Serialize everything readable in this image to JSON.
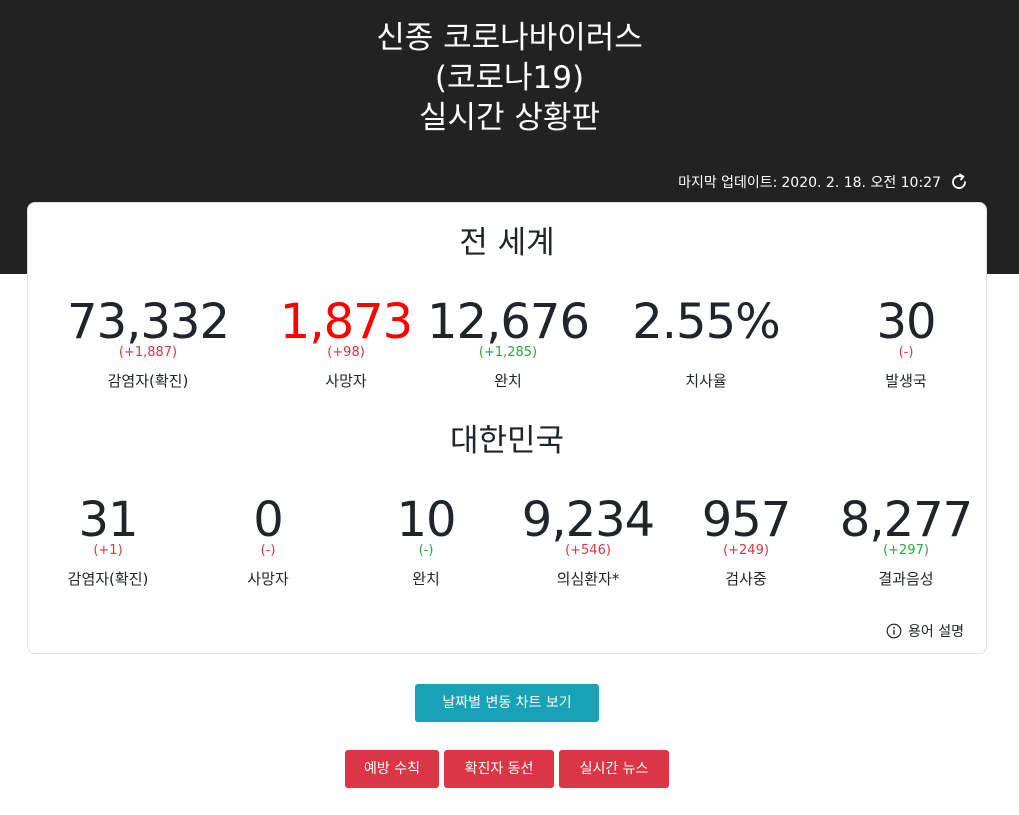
{
  "header": {
    "title_line1": "신종 코로나바이러스",
    "title_line2": "(코로나19)",
    "title_line3": "실시간 상황판",
    "update_label": "마지막 업데이트:",
    "update_time": "2020. 2. 18. 오전 10:27",
    "refresh_icon": "refresh-icon"
  },
  "world": {
    "title": "전 세계",
    "stats": [
      {
        "value": "73,332",
        "delta": "(+1,887)",
        "label": "감염자(확진)",
        "delta_color": "#dc3545",
        "value_color": "#212529"
      },
      {
        "value": "1,873",
        "delta": "(+98)",
        "label": "사망자",
        "delta_color": "#dc3545",
        "value_color": "#ff0000"
      },
      {
        "value": "12,676",
        "delta": "(+1,285)",
        "label": "완치",
        "delta_color": "#28a745",
        "value_color": "#212529"
      },
      {
        "value": "2.55%",
        "delta": "",
        "label": "치사율",
        "delta_color": "#dc3545",
        "value_color": "#212529"
      },
      {
        "value": "30",
        "delta": "(-)",
        "label": "발생국",
        "delta_color": "#dc3545",
        "value_color": "#212529"
      }
    ]
  },
  "korea": {
    "title": "대한민국",
    "stats": [
      {
        "value": "31",
        "delta": "(+1)",
        "label": "감염자(확진)",
        "delta_color": "#dc3545"
      },
      {
        "value": "0",
        "delta": "(-)",
        "label": "사망자",
        "delta_color": "#dc3545"
      },
      {
        "value": "10",
        "delta": "(-)",
        "label": "완치",
        "delta_color": "#28a745"
      },
      {
        "value": "9,234",
        "delta": "(+546)",
        "label": "의심환자*",
        "delta_color": "#dc3545"
      },
      {
        "value": "957",
        "delta": "(+249)",
        "label": "검사중",
        "delta_color": "#dc3545"
      },
      {
        "value": "8,277",
        "delta": "(+297)",
        "label": "결과음성",
        "delta_color": "#28a745"
      }
    ]
  },
  "glossary": {
    "label": "용어 설명",
    "icon": "info-icon"
  },
  "buttons": {
    "chart": "날짜별 변동 차트 보기",
    "prevention": "예방 수칙",
    "route": "확진자 동선",
    "news": "실시간 뉴스"
  },
  "colors": {
    "hero_bg": "#222222",
    "chart_button": "#17a2b8",
    "red_button": "#dc3545",
    "increase": "#dc3545",
    "recovered": "#28a745"
  }
}
